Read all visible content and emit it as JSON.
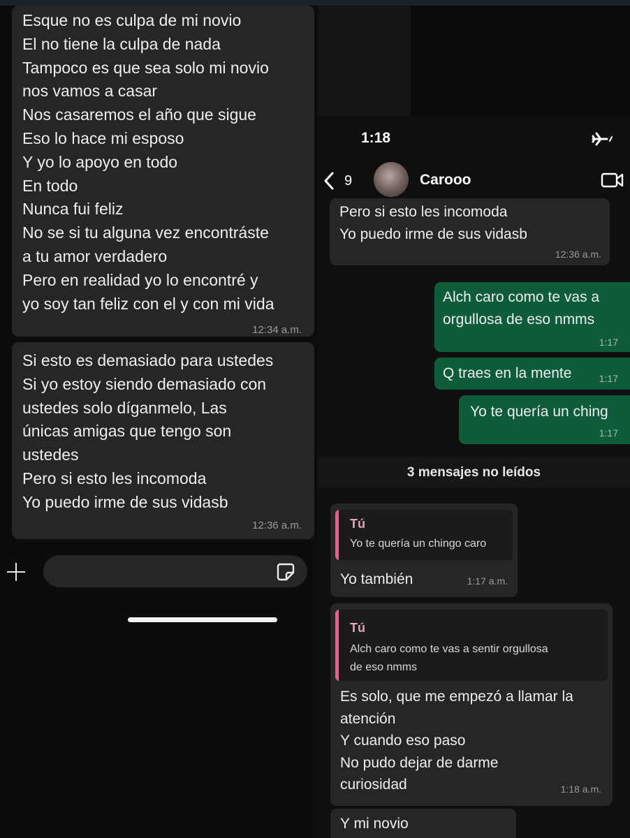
{
  "left": {
    "bubble1": {
      "lines": [
        "Esque no es culpa de mi novio",
        "El no tiene la culpa de nada",
        "Tampoco es que sea solo mi novio",
        "nos vamos a casar",
        "Nos casaremos el año que sigue",
        "Eso lo hace mi esposo",
        "Y yo lo apoyo en todo",
        "En todo",
        "Nunca fui feliz",
        "No se si tu alguna vez encontráste",
        "a tu amor verdadero",
        "Pero en realidad yo lo encontré y",
        "yo soy tan feliz con el y con mi vida"
      ],
      "time": "12:34 a.m."
    },
    "bubble2": {
      "lines": [
        "Si esto es demasiado para ustedes",
        "Si yo estoy siendo demasiado con",
        "ustedes solo díganmelo, Las",
        "únicas amigas que tengo son",
        "ustedes",
        "Pero si esto les incomoda",
        "Yo puedo irme de sus vidasb"
      ],
      "time": "12:36 a.m."
    },
    "icons": [
      "plus-icon",
      "sticker-icon"
    ]
  },
  "right": {
    "status_time": "1:18",
    "back_count": "9",
    "contact_name": "Carooo",
    "icons": [
      "airplane-icon",
      "back-chevron-icon",
      "video-call-icon"
    ],
    "msg_in_1": {
      "lines": [
        "Pero si esto les incomoda",
        "Yo puedo irme de sus vidasb"
      ],
      "time": "12:36 a.m."
    },
    "msg_out_1": {
      "lines": [
        "Alch caro como te vas a",
        "orgullosa de eso nmms"
      ],
      "time": "1:17"
    },
    "msg_out_2": {
      "text": "Q traes en la mente",
      "time": "1:17"
    },
    "msg_out_3": {
      "text": "Yo te quería un ching",
      "time": "1:17"
    },
    "unread_label": "3 mensajes no leídos",
    "reply1": {
      "quote_name": "Tú",
      "quote_text": "Yo te quería un chingo caro",
      "text": "Yo también",
      "time": "1:17 a.m."
    },
    "reply2": {
      "quote_name": "Tú",
      "quote_lines": [
        "Alch caro como te vas a sentir orgullosa",
        "de eso nmms"
      ],
      "lines": [
        "Es solo, que me empezó a llamar la",
        "atención",
        "Y cuando eso paso",
        "No pudo dejar de darme",
        "curiosidad"
      ],
      "time": "1:18 a.m."
    },
    "last_msg": {
      "text": "Y mi novio"
    },
    "colors": {
      "incoming_bubble": "#262626",
      "outgoing_bubble": "#0f5c3a",
      "quote_accent": "#d6688f"
    }
  }
}
